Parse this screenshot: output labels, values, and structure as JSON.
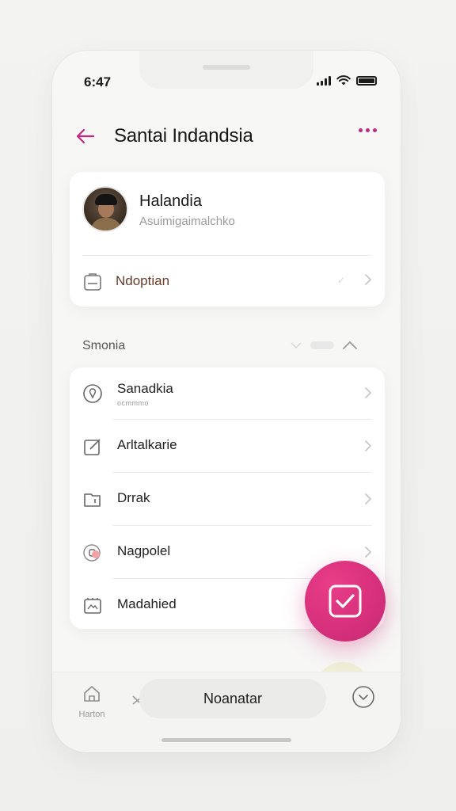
{
  "status_bar": {
    "time": "6:47"
  },
  "header": {
    "title": "Santai Indandsia"
  },
  "profile": {
    "name": "Halandia",
    "subtitle": "Asuimigaimalchko",
    "row_label": "Ndoptian"
  },
  "section": {
    "title": "Smonia"
  },
  "list": {
    "items": [
      {
        "label": "Sanadkia",
        "sublabel": "ocmmmo",
        "icon": "location-circle-icon"
      },
      {
        "label": "Arltalkarie",
        "icon": "edit-square-icon"
      },
      {
        "label": "Drrak",
        "icon": "folder-icon"
      },
      {
        "label": "Nagpolel",
        "icon": "toggle-icon"
      },
      {
        "label": "Madahied",
        "icon": "image-frame-icon"
      }
    ]
  },
  "fab": {
    "icon": "check-square-icon"
  },
  "bottom_nav": {
    "home_label": "Harton",
    "center_label": "Noanatar"
  },
  "colors": {
    "accent": "#c2287e",
    "fab": "#d8307c",
    "background": "#f3f3f1"
  }
}
